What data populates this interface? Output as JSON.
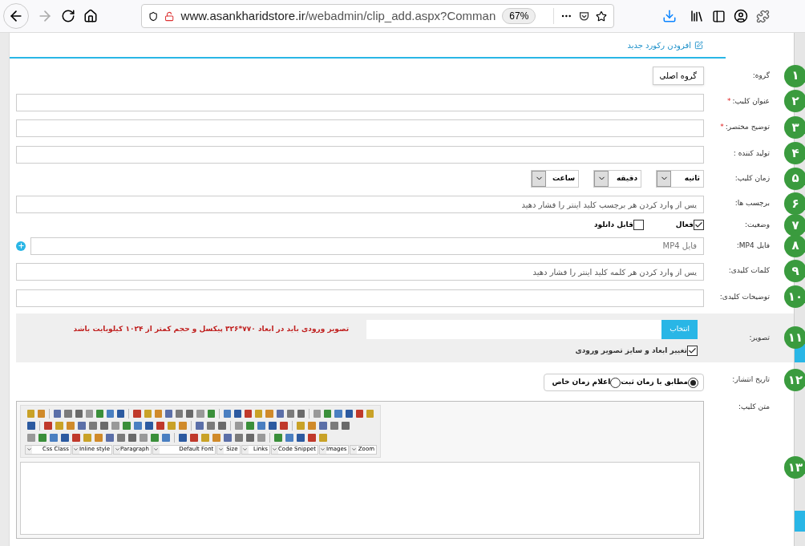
{
  "browser": {
    "url_host": "www.asankharidstore.ir",
    "url_path": "/webadmin/clip_add.aspx?Comman",
    "zoom": "67%"
  },
  "header": {
    "title": "افزودن رکورد جدید"
  },
  "fields": [
    {
      "kind": "group",
      "number": "۱",
      "label": "گروه:",
      "button": "گروه اصلی"
    },
    {
      "kind": "text",
      "number": "۲",
      "label": "عنوان کلیپ:",
      "required_mark": "*"
    },
    {
      "kind": "text",
      "number": "۳",
      "label": "توضیح مختصر:",
      "required_mark": "*"
    },
    {
      "kind": "text",
      "number": "۴",
      "label": "تولید کننده :"
    },
    {
      "kind": "time",
      "number": "۵",
      "label": "زمان کلیپ:",
      "selects": [
        "ثانیه",
        "دقیقه",
        "ساعت"
      ]
    },
    {
      "kind": "text",
      "number": "۶",
      "label": "برچسب ها:",
      "placeholder": "پس از وارد کردن هر برچسب کلید اینتر را فشار دهید"
    },
    {
      "kind": "checks",
      "number": "۷",
      "label": "وضعیت:",
      "options": [
        {
          "label": "فعال",
          "checked": true
        },
        {
          "label": "قابل دانلود",
          "checked": false
        }
      ]
    },
    {
      "kind": "file",
      "number": "۸",
      "label": "فایل MP4:",
      "placeholder": "فایل MP4"
    },
    {
      "kind": "text",
      "number": "۹",
      "label": "کلمات کلیدی:",
      "placeholder": "پس از وارد کردن هر کلمه کلید اینتر را فشار دهید"
    },
    {
      "kind": "text",
      "number": "۱۰",
      "label": "توضیحات کلیدی:"
    },
    {
      "kind": "image",
      "number": "۱۱",
      "label": "تصویر:",
      "button": "انتخاب",
      "note": "تصویر ورودی باید در ابعاد ۷۷۰*۳۲۶ پیکسل و حجم کمتر از ۱۰۲۴ کیلوبایت باشد",
      "option": {
        "label": "تغییر ابعاد و سایز تصویر ورودی",
        "checked": true
      }
    },
    {
      "kind": "radio",
      "number": "۱۲",
      "label": "تاریخ انتشار:",
      "options": [
        {
          "label": "مطابق با زمان ثبت",
          "selected": true
        },
        {
          "label": "اعلام زمان خاص",
          "selected": false
        }
      ]
    },
    {
      "kind": "editor",
      "number": "۱۳",
      "label": "متن کلیپ:",
      "dropdowns": [
        "Zoom",
        "Images",
        "Code Snippet",
        "Links",
        "Size",
        "Default Font",
        "Paragraph",
        "Inline style",
        "Css Class"
      ]
    }
  ]
}
